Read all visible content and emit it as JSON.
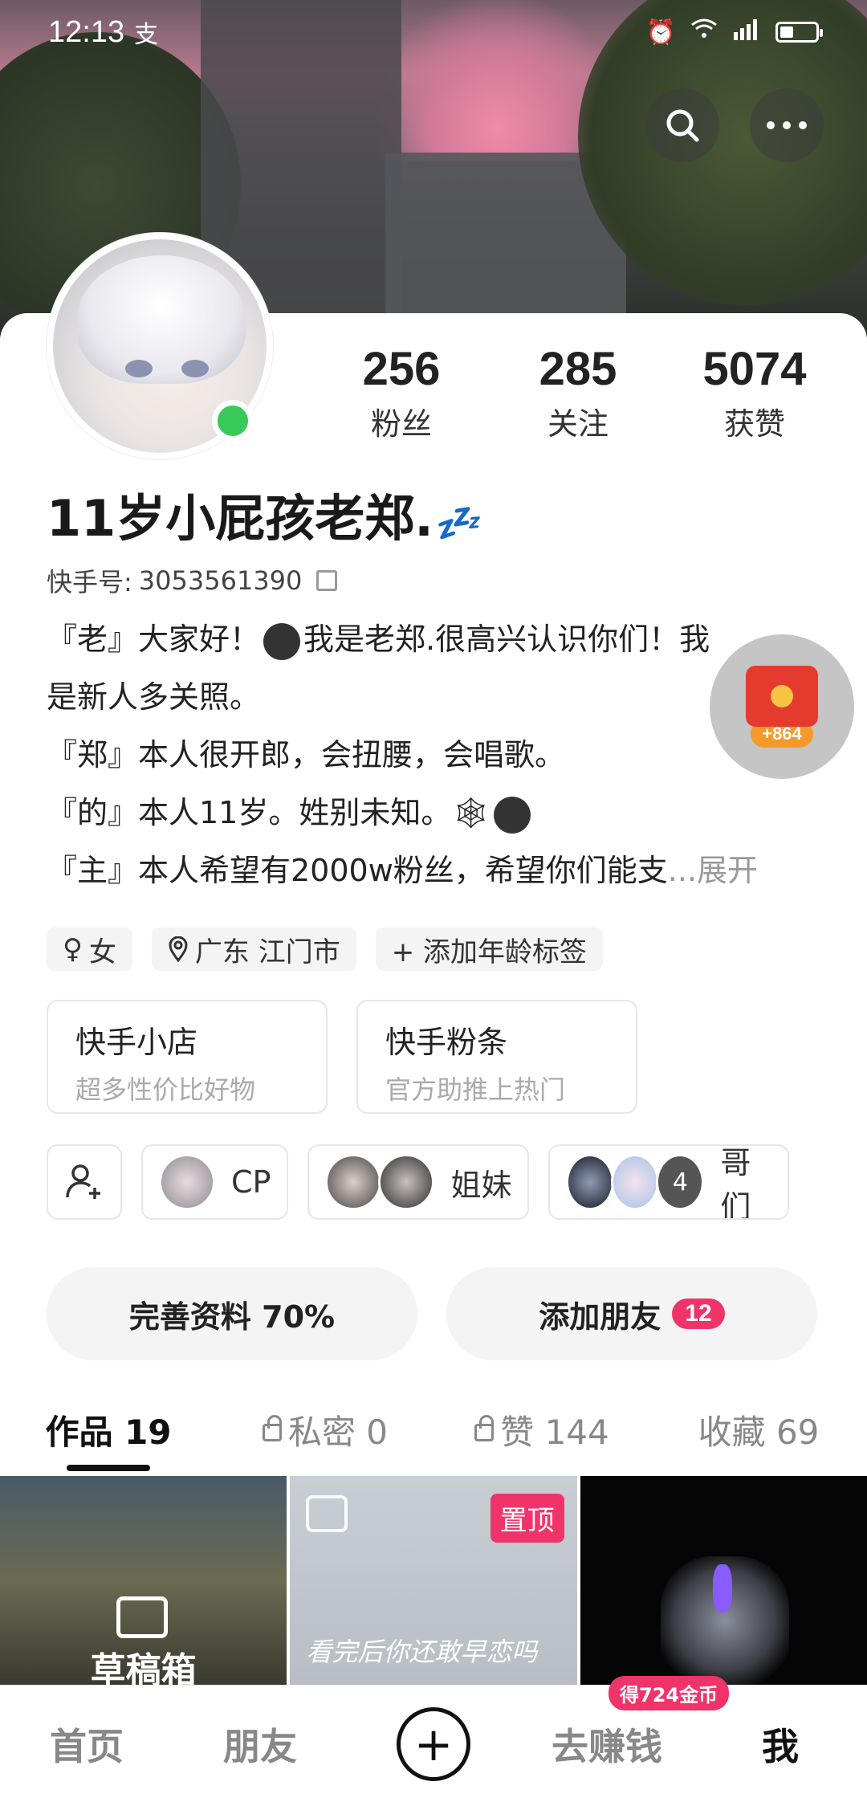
{
  "status_bar": {
    "time": "12:13",
    "app_indicator": "支",
    "network": "4G"
  },
  "profile": {
    "nickname": "11岁小屁孩老郑.",
    "nickname_emoji": "💤",
    "kuaishou_id_label": "快手号:",
    "kuaishou_id": "3053561390",
    "stats": [
      {
        "value": "256",
        "label": "粉丝"
      },
      {
        "value": "285",
        "label": "关注"
      },
      {
        "value": "5074",
        "label": "获赞"
      }
    ],
    "bio": {
      "line1": "『老』大家好！",
      "line1b": "我是老郑.很高兴认识你们！我",
      "line2": "是新人多关照。",
      "line3": "『郑』本人很开郎，会扭腰，会唱歌。",
      "line4": "『的』本人11岁。姓别未知。",
      "line5": "『主』本人希望有2000w粉丝，希望你们能支",
      "expand": "...展开"
    },
    "tags": [
      "女",
      "广东 江门市",
      "+ 添加年龄标签"
    ]
  },
  "red_packet": {
    "amount": "+864"
  },
  "shops": [
    {
      "title": "快手小店",
      "subtitle": "超多性价比好物"
    },
    {
      "title": "快手粉条",
      "subtitle": "官方助推上热门"
    }
  ],
  "relations": [
    {
      "label": "CP"
    },
    {
      "label": "姐妹"
    },
    {
      "label": "哥们",
      "count": "4"
    }
  ],
  "actions": {
    "complete_profile": "完善资料 70%",
    "add_friend": "添加朋友",
    "add_friend_count": "12"
  },
  "tabs": [
    {
      "label": "作品 19"
    },
    {
      "label": "私密 0"
    },
    {
      "label": "赞 144"
    },
    {
      "label": "收藏 69"
    }
  ],
  "grid": {
    "draft_label": "草稿箱",
    "pinned_label": "置顶",
    "caption": "看完后你还敢早恋吗"
  },
  "bottom_nav": {
    "home": "首页",
    "friends": "朋友",
    "earn": "去赚钱",
    "earn_badge": "得724金币",
    "me": "我"
  },
  "colors": {
    "accent_pink": "#f0346a",
    "online_green": "#38c95a"
  }
}
